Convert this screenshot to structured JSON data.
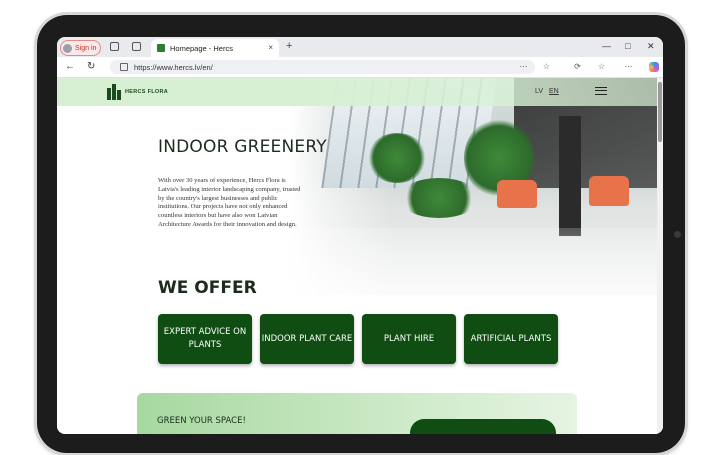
{
  "browser": {
    "signin_label": "Sign in",
    "tab_title": "Homepage - Hercs",
    "tab_close": "×",
    "new_tab": "+",
    "url": "https://www.hercs.lv/en/",
    "window_controls": [
      "—",
      "□",
      "✕"
    ]
  },
  "site": {
    "logo_text": "HERCS FLORA",
    "languages": [
      "LV",
      "EN"
    ],
    "active_language": "EN",
    "hero_title": "INDOOR GREENERY",
    "hero_text": "With over 30 years of experience, Hercs Flora is Latvia's leading interior landscaping company, trusted by the country's largest businesses and public institutions. Our projects have not only enhanced countless interiors but have also won Latvian Architecture Awards for their innovation and design.",
    "offer_title": "WE OFFER",
    "offers": [
      "EXPERT ADVICE ON PLANTS",
      "INDOOR PLANT CARE",
      "PLANT HIRE",
      "ARTIFICIAL PLANTS"
    ],
    "cta_title": "GREEN YOUR SPACE!"
  },
  "colors": {
    "brand_green": "#0f4d12",
    "header_green": "#d7f0d4",
    "signin_red": "#c42b1c"
  }
}
